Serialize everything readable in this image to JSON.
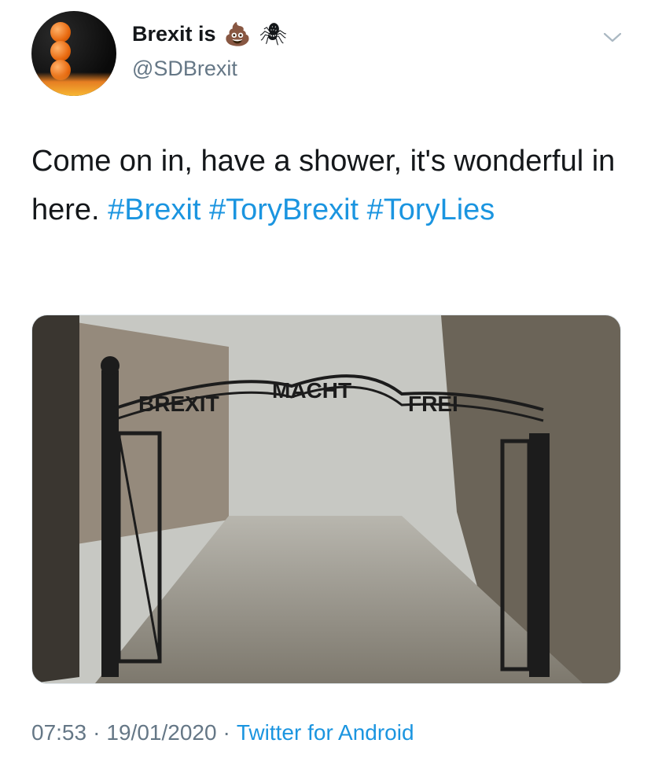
{
  "tweet": {
    "display_name": "Brexit is",
    "name_emojis": [
      "💩",
      "🕷"
    ],
    "handle": "@SDBrexit",
    "text_parts": [
      {
        "text": "Come on in, have a shower, it's wonderful in here. ",
        "type": "text"
      },
      {
        "text": "#Brexit",
        "type": "hashtag"
      },
      {
        "text": " ",
        "type": "text"
      },
      {
        "text": "#ToryBrexit",
        "type": "hashtag"
      },
      {
        "text": " ",
        "type": "text"
      },
      {
        "text": "#ToryLies",
        "type": "hashtag"
      }
    ],
    "media": {
      "sign_words": [
        "BREXIT",
        "MACHT",
        "FREI"
      ]
    },
    "time": "07:53",
    "date": "19/01/2020",
    "separator": "·",
    "source": "Twitter for Android"
  },
  "icons": {
    "menu": "chevron-down-icon"
  },
  "colors": {
    "link": "#1b95e0",
    "secondary": "#657786",
    "text": "#14171a"
  }
}
